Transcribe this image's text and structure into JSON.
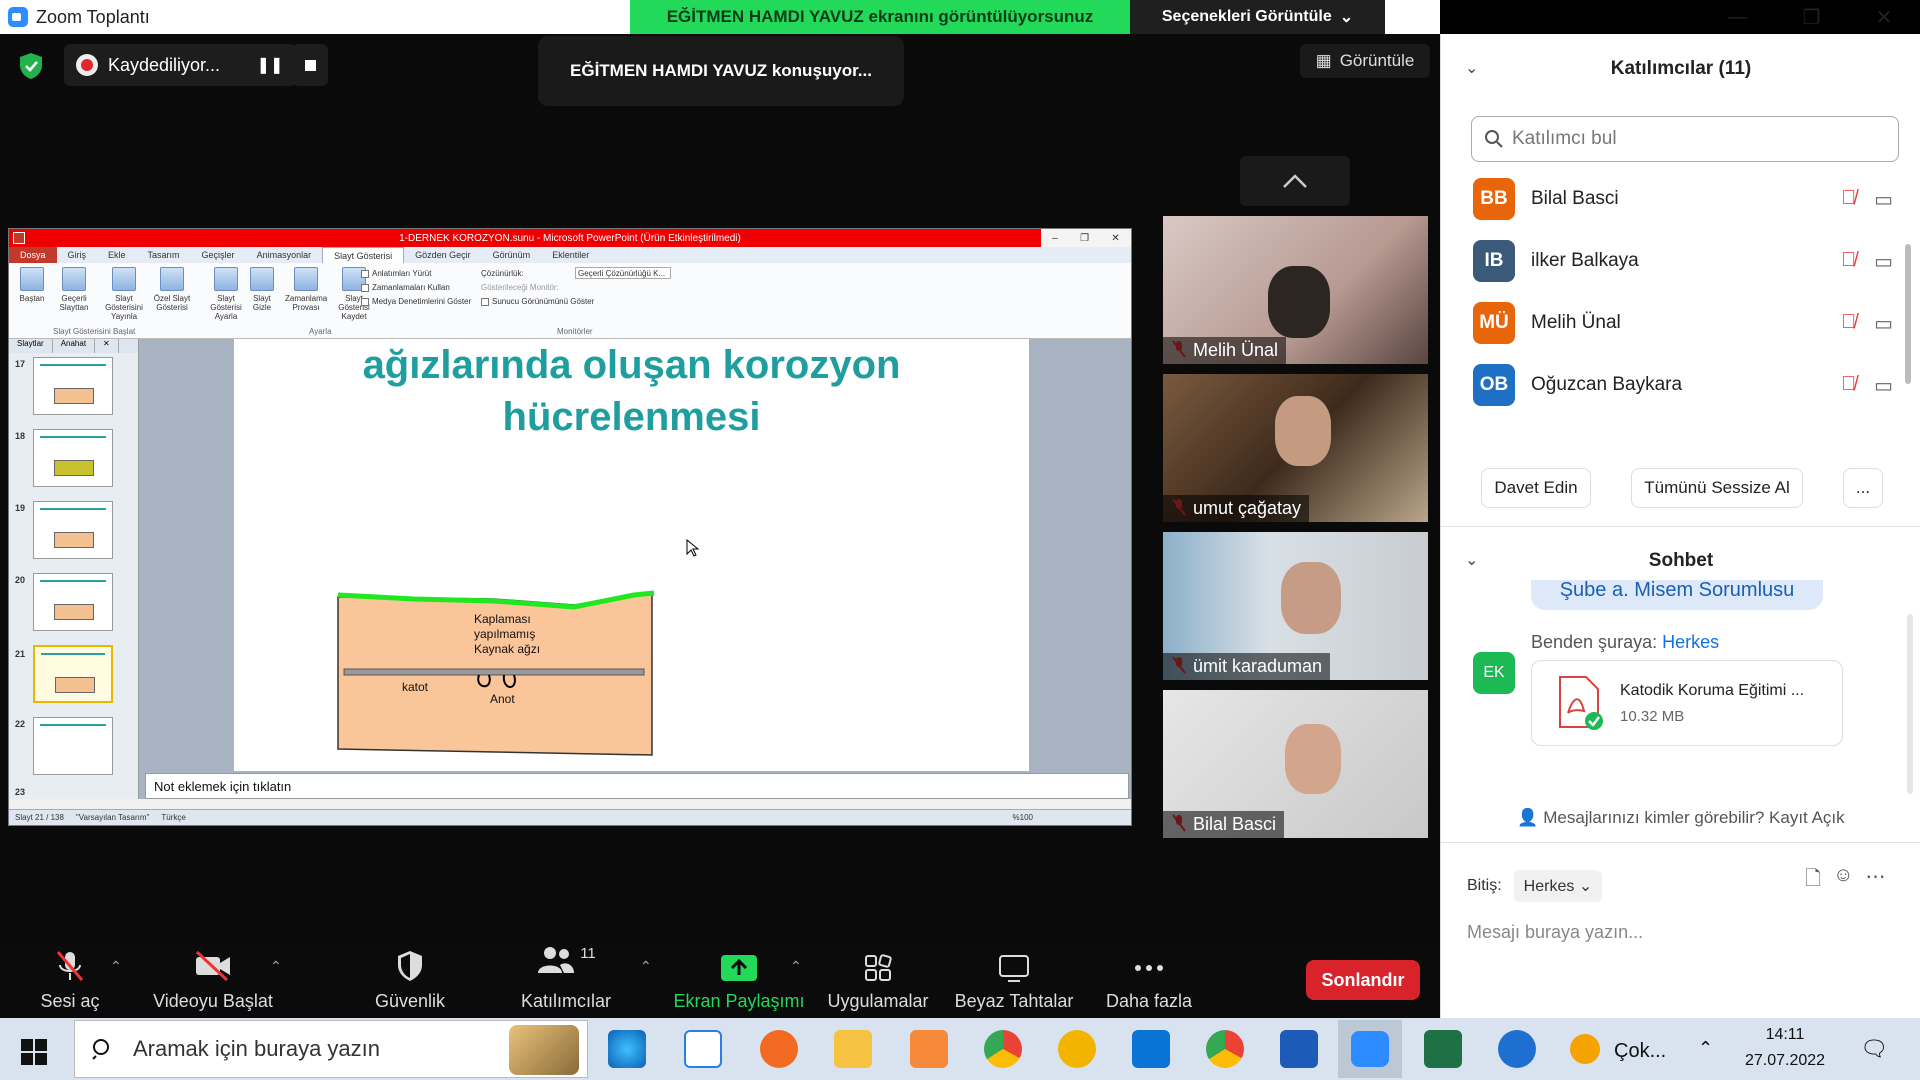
{
  "window": {
    "title": "Zoom Toplantı"
  },
  "banner": {
    "sharing_text": "EĞİTMEN HAMDI YAVUZ ekranını görüntülüyorsunuz",
    "view_options": "Seçenekleri Görüntüle"
  },
  "recording": {
    "label": "Kaydediliyor..."
  },
  "speaker_label": "EĞİTMEN HAMDI YAVUZ konuşuyor...",
  "gallery_label": "Görüntüle",
  "ppt": {
    "title": "1-DERNEK KOROZYON.sunu - Microsoft PowerPoint (Ürün Etkinleştirilmedi)",
    "tabs": [
      "Dosya",
      "Giriş",
      "Ekle",
      "Tasarım",
      "Geçişler",
      "Animasyonlar",
      "Slayt Gösterisi",
      "Gözden Geçir",
      "Görünüm",
      "Eklentiler"
    ],
    "ribbon_buttons": [
      "Baştan",
      "Geçerli Slayttan",
      "Slayt Gösterisini Yayınla",
      "Özel Slayt Gösterisi",
      "Slayt Gösterisi Ayarla",
      "Slayt Gizle",
      "Zamanlama Provası",
      "Slayt Gösterisi Kaydet"
    ],
    "checks": [
      "Anlatımları Yürüt",
      "Zamanlamaları Kullan",
      "Medya Denetimlerini Göster"
    ],
    "monitor": {
      "resolution_label": "Çözünürlük:",
      "resolution_value": "Geçerli Çözünürlüğü K...",
      "show_on": "Gösterileceği Monitör:",
      "presenter": "Sunucu Görünümünü Göster"
    },
    "groups": [
      "Slayt Gösterisini Başlat",
      "Ayarla",
      "Monitörler"
    ],
    "panel_tabs": [
      "Slaytlar",
      "Anahat"
    ],
    "thumb_numbers": [
      "17",
      "18",
      "19",
      "20",
      "21",
      "22",
      "23"
    ],
    "slide_title_1": "ağızlarında oluşan korozyon",
    "slide_title_2": "hücrelenmesi",
    "diagram": {
      "label_1": "Kaplaması",
      "label_2": "yapılmamış",
      "label_3": "Kaynak ağzı",
      "katot": "katot",
      "anot": "Anot"
    },
    "notes": "Not eklemek için tıklatın",
    "status": {
      "slide": "Slayt 21 / 138",
      "theme": "\"Varsayılan Tasarım\"",
      "lang": "Türkçe",
      "zoom": "%100"
    }
  },
  "videos": [
    "Melih Ünal",
    "umut çağatay",
    "ümit karaduman",
    "Bilal Basci"
  ],
  "toolbar": {
    "unmute": "Sesi aç",
    "video": "Videoyu Başlat",
    "security": "Güvenlik",
    "participants": "Katılımcılar",
    "participants_count": "11",
    "share": "Ekran Paylaşımı",
    "apps": "Uygulamalar",
    "whiteboard": "Beyaz Tahtalar",
    "more": "Daha fazla",
    "end": "Sonlandır"
  },
  "panel": {
    "participants_title": "Katılımcılar (11)",
    "find_placeholder": "Katılımcı bul",
    "people": [
      {
        "initials": "BB",
        "name": "Bilal Basci",
        "color": "#e8650a"
      },
      {
        "initials": "IB",
        "name": "ilker Balkaya",
        "color": "#3b5a7a"
      },
      {
        "initials": "MÜ",
        "name": "Melih Ünal",
        "color": "#e8650a"
      },
      {
        "initials": "OB",
        "name": "Oğuzcan Baykara",
        "color": "#1f6fc4"
      }
    ],
    "invite": "Davet Edin",
    "mute_all": "Tümünü Sessize Al",
    "more": "...",
    "chat_title": "Sohbet",
    "prev_msg": "Şube a. Misem Sorumlusu",
    "from_prefix": "Benden şuraya:",
    "from_target": "Herkes",
    "sender_initials": "EK",
    "file_name": "Katodik Koruma Eğitimi ...",
    "file_size": "10.32 MB",
    "who_sees": "Mesajlarınızı kimler görebilir? Kayıt Açık",
    "to_label": "Bitiş:",
    "to_value": "Herkes",
    "input_placeholder": "Mesajı buraya yazın..."
  },
  "taskbar": {
    "search": "Aramak için buraya yazın",
    "tray_label": "Çok...",
    "time": "14:11",
    "date": "27.07.2022"
  },
  "colors": {
    "share_green": "#23d959",
    "end_red": "#d8232a",
    "zoom_blue": "#0e71eb",
    "slide_title": "#1f9ea0"
  }
}
